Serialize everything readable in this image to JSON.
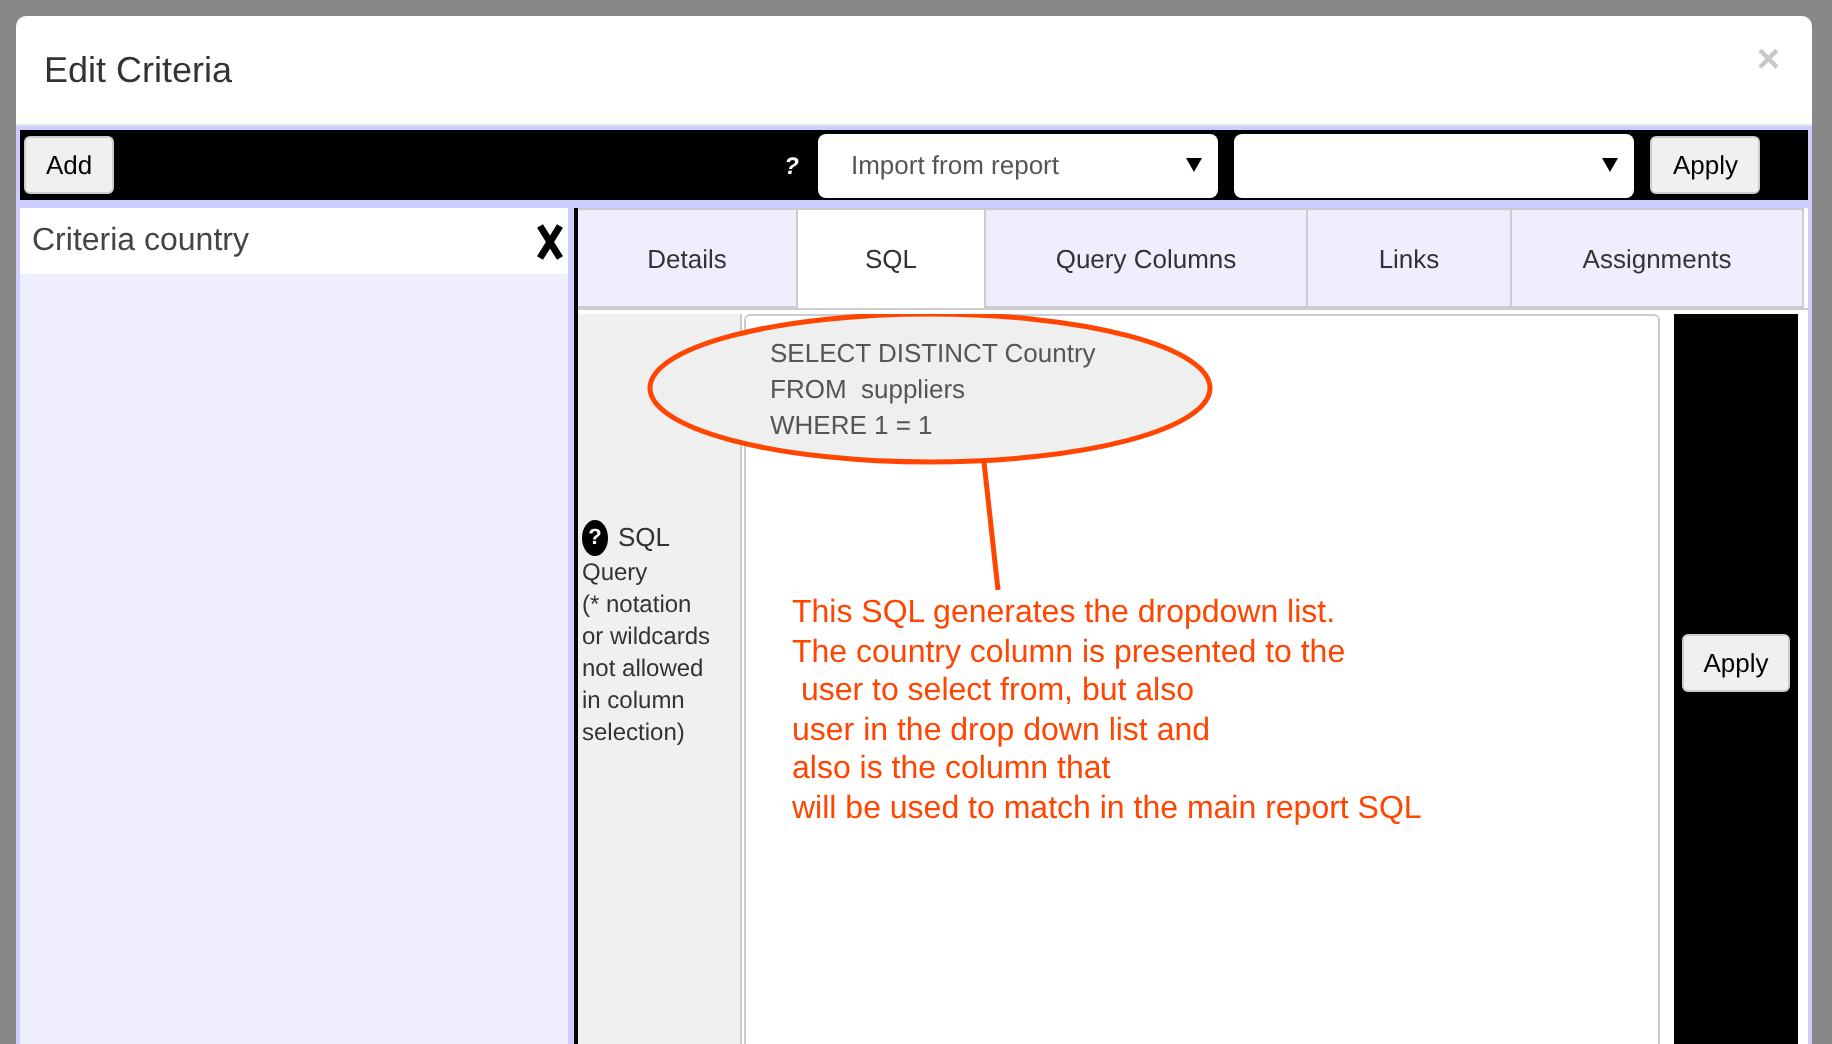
{
  "dialog": {
    "title": "Edit Criteria",
    "close": "×"
  },
  "toolbar": {
    "add": "Add",
    "help": "?",
    "import_select": "Import from report",
    "apply": "Apply"
  },
  "criteria": [
    {
      "label": "Criteria country",
      "selected": true
    }
  ],
  "tabs": [
    {
      "label": "Details",
      "selected": false
    },
    {
      "label": "SQL",
      "selected": true
    },
    {
      "label": "Query Columns",
      "selected": false
    },
    {
      "label": "Links",
      "selected": false
    },
    {
      "label": "Assignments",
      "selected": false
    }
  ],
  "sql_field": {
    "help": "?",
    "label_title": "SQL",
    "label_rest": "Query\n(* notation\nor wildcards\nnot allowed\nin column\nselection)",
    "value": "SELECT DISTINCT Country\nFROM  suppliers\nWHERE 1 = 1"
  },
  "annotation": "This SQL generates the dropdown list.\nThe country column is presented to the\n user to select from, but also\nuser in the drop down list and\nalso is the column that\nwill be used to match in the main report SQL",
  "side_apply": "Apply"
}
